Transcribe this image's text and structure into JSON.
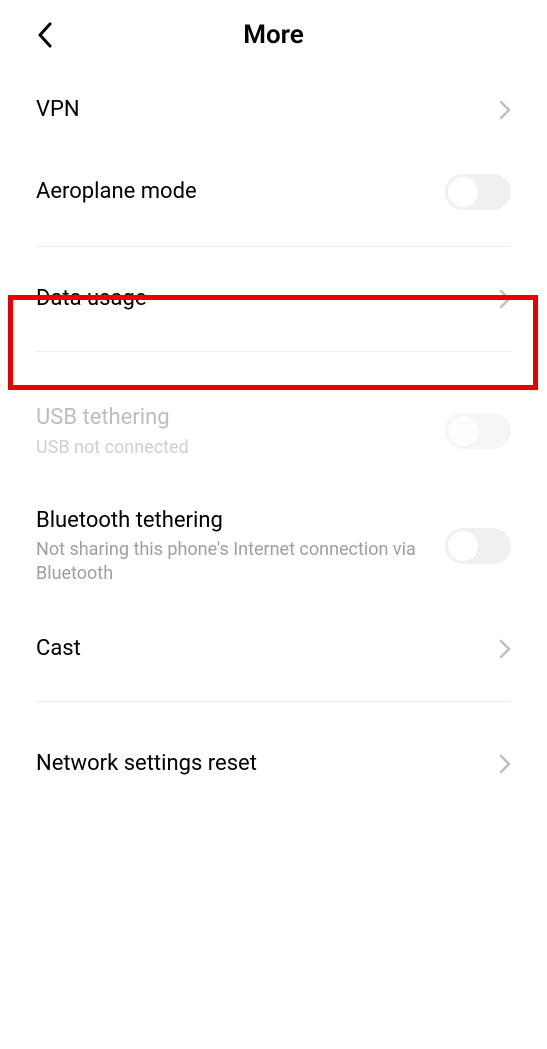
{
  "header": {
    "title": "More"
  },
  "items": {
    "vpn": {
      "title": "VPN"
    },
    "aeroplane": {
      "title": "Aeroplane mode"
    },
    "data_usage": {
      "title": "Data usage"
    },
    "usb_tethering": {
      "title": "USB tethering",
      "subtitle": "USB not connected"
    },
    "bluetooth_tethering": {
      "title": "Bluetooth tethering",
      "subtitle": "Not sharing this phone's Internet connection via Bluetooth"
    },
    "cast": {
      "title": "Cast"
    },
    "network_reset": {
      "title": "Network settings reset"
    }
  }
}
